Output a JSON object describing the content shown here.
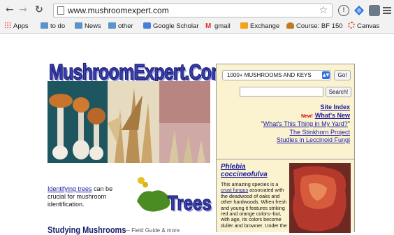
{
  "browser": {
    "url": "www.mushroomexpert.com",
    "bookmarks": [
      {
        "label": "Apps",
        "icon": "apps-grid-icon"
      },
      {
        "label": "to do",
        "icon": "folder-icon"
      },
      {
        "label": "News",
        "icon": "folder-icon"
      },
      {
        "label": "other",
        "icon": "folder-icon"
      },
      {
        "label": "Google Scholar",
        "icon": "scholar-icon"
      },
      {
        "label": "gmail",
        "icon": "gmail-icon"
      },
      {
        "label": "Exchange",
        "icon": "exchange-icon"
      },
      {
        "label": "Course: BF 150",
        "icon": "course-icon"
      },
      {
        "label": "Canvas",
        "icon": "canvas-icon"
      }
    ]
  },
  "site": {
    "logo": "MushroomExpert.Com",
    "trees": {
      "link": "Identifying trees",
      "text": " can be crucial for mushroom identification.",
      "logo_word": "Trees"
    },
    "studying": "Studying Mushrooms",
    "studying_sub": "— Field Guide & more"
  },
  "panel": {
    "select_value": "1000+ MUSHROOMS AND KEYS",
    "go_label": "Go!",
    "search_value": "",
    "search_label": "Search!",
    "links": {
      "site_index": "Site Index",
      "new_badge": "New!",
      "whats_new": "What's New",
      "yard_open": "\"",
      "yard": "What's This Thing in My Yard?",
      "yard_close": "\"",
      "stinkhorn": "The Stinkhorn Project",
      "leccinoid": "Studies in Leccinoid Fungi"
    }
  },
  "featured": {
    "title": "Phlebia coccineofulva",
    "text_1": "This amazing species is a ",
    "text_link": "crust fungus",
    "text_2": " associated with the deadwood of oaks and other hardwoods. When fresh and young it features striking red and orange colors--but, with age, its colors become duller and browner. Under the"
  },
  "colors": {
    "logo_blue": "#3a3fb0",
    "panel_bg": "#fbf3cf",
    "link_blue": "#1a1aa6",
    "new_red": "#d20000"
  }
}
